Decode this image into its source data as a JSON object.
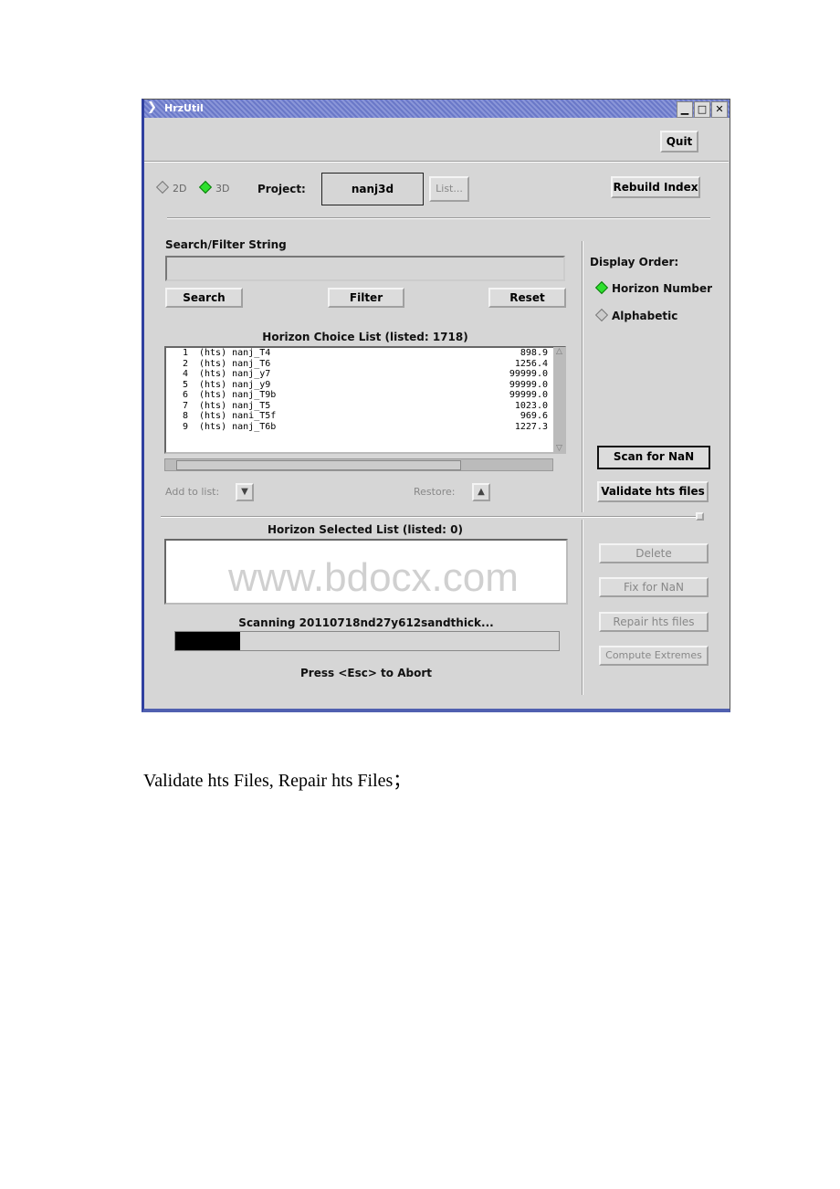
{
  "window": {
    "title": "HrzUtil",
    "controls": [
      "minimize",
      "maximize",
      "close"
    ]
  },
  "toolbar": {
    "quit": "Quit"
  },
  "project": {
    "mode_2d": "2D",
    "mode_3d": "3D",
    "selected_mode": "3D",
    "label": "Project:",
    "value": "nanj3d",
    "list_button": "List...",
    "rebuild": "Rebuild Index"
  },
  "search": {
    "label": "Search/Filter String",
    "value": "",
    "search_button": "Search",
    "filter_button": "Filter",
    "reset_button": "Reset"
  },
  "display_order": {
    "label": "Display Order:",
    "options": [
      "Horizon Number",
      "Alphabetic"
    ],
    "selected": "Horizon Number"
  },
  "choice_list": {
    "title": "Horizon Choice List (listed: 1718)",
    "rows": [
      {
        "n": "1",
        "name": "(hts) nanj_T4",
        "value": "898.9"
      },
      {
        "n": "2",
        "name": "(hts) nanj_T6",
        "value": "1256.4"
      },
      {
        "n": "4",
        "name": "(hts) nanj_y7",
        "value": "99999.0"
      },
      {
        "n": "5",
        "name": "(hts) nanj_y9",
        "value": "99999.0"
      },
      {
        "n": "6",
        "name": "(hts) nanj_T9b",
        "value": "99999.0"
      },
      {
        "n": "7",
        "name": "(hts) nanj_T5",
        "value": "1023.0"
      },
      {
        "n": "8",
        "name": "(hts) nani_T5f",
        "value": "969.6"
      },
      {
        "n": "9",
        "name": "(hts) nanj_T6b",
        "value": "1227.3"
      }
    ]
  },
  "list_actions": {
    "add": "Add to list:",
    "restore": "Restore:"
  },
  "right_buttons": {
    "scan": "Scan for NaN",
    "validate": "Validate hts files",
    "delete": "Delete",
    "fix": "Fix for NaN",
    "repair": "Repair hts files",
    "compute": "Compute Extremes"
  },
  "selected_list": {
    "title": "Horizon Selected List (listed: 0)"
  },
  "progress": {
    "status": "Scanning 20110718nd27y612sandthick...",
    "percent": 17,
    "abort": "Press <Esc> to Abort"
  },
  "watermark": "www.bdocx.com",
  "caption": "Validate hts Files, Repair hts Files；",
  "colors": {
    "titlebar": "#7a86d0",
    "radio_on": "#2ee02e",
    "progress": "#000000"
  }
}
